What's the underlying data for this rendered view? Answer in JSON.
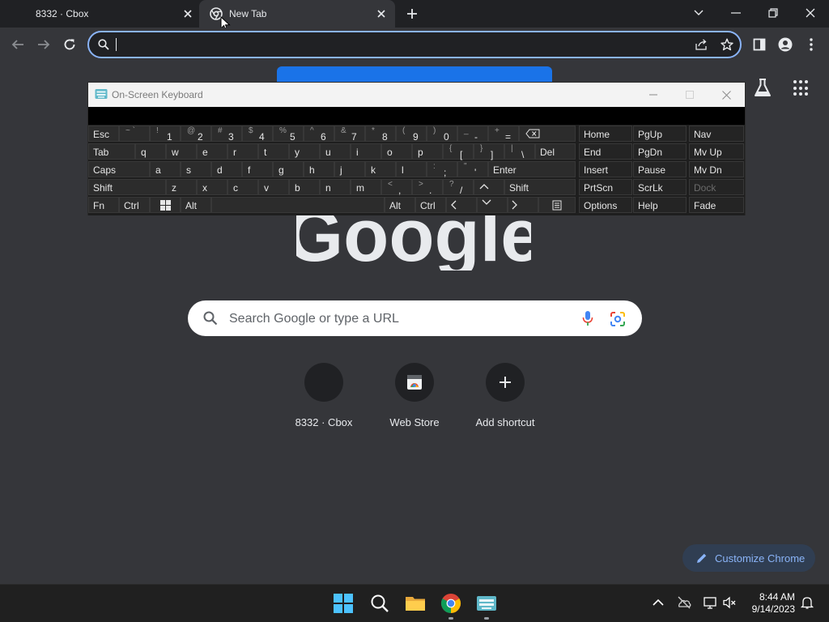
{
  "tabs": [
    {
      "title": "8332 · Cbox",
      "active": false
    },
    {
      "title": "New Tab",
      "active": true
    }
  ],
  "omnibox": {
    "value": "",
    "placeholder": ""
  },
  "page": {
    "logo_text": "Google",
    "search_placeholder": "Search Google or type a URL",
    "shortcuts": [
      {
        "label": "8332 · Cbox",
        "icon": "blank-favicon"
      },
      {
        "label": "Web Store",
        "icon": "web-store-icon"
      },
      {
        "label": "Add shortcut",
        "icon": "plus-icon"
      }
    ],
    "customize_label": "Customize Chrome"
  },
  "osk": {
    "title": "On-Screen Keyboard",
    "row1": {
      "esc": "Esc",
      "tilde": {
        "top": "~",
        "main": "`"
      },
      "n1": {
        "top": "!",
        "main": "1"
      },
      "n2": {
        "top": "@",
        "main": "2"
      },
      "n3": {
        "top": "#",
        "main": "3"
      },
      "n4": {
        "top": "$",
        "main": "4"
      },
      "n5": {
        "top": "%",
        "main": "5"
      },
      "n6": {
        "top": "^",
        "main": "6"
      },
      "n7": {
        "top": "&",
        "main": "7"
      },
      "n8": {
        "top": "*",
        "main": "8"
      },
      "n9": {
        "top": "(",
        "main": "9"
      },
      "n0": {
        "top": ")",
        "main": "0"
      },
      "minus": {
        "top": "_",
        "main": "-"
      },
      "equals": {
        "top": "+",
        "main": "="
      }
    },
    "row2": {
      "tab": "Tab",
      "letters": [
        "q",
        "w",
        "e",
        "r",
        "t",
        "y",
        "u",
        "i",
        "o",
        "p"
      ],
      "lbracket": {
        "top": "{",
        "main": "["
      },
      "rbracket": {
        "top": "}",
        "main": "]"
      },
      "backslash": {
        "top": "|",
        "main": "\\"
      },
      "del": "Del"
    },
    "row3": {
      "caps": "Caps",
      "letters": [
        "a",
        "s",
        "d",
        "f",
        "g",
        "h",
        "j",
        "k",
        "l"
      ],
      "semicolon": {
        "top": ":",
        "main": ";"
      },
      "quote": {
        "top": "\"",
        "main": "'"
      },
      "enter": "Enter"
    },
    "row4": {
      "shift_left": "Shift",
      "letters": [
        "z",
        "x",
        "c",
        "v",
        "b",
        "n",
        "m"
      ],
      "comma": {
        "top": "<",
        "main": ","
      },
      "period": {
        "top": ">",
        "main": "."
      },
      "slash": {
        "top": "?",
        "main": "/"
      },
      "shift_right": "Shift"
    },
    "row5": {
      "fn": "Fn",
      "ctrl_left": "Ctrl",
      "alt_left": "Alt",
      "alt_right": "Alt",
      "ctrl_right": "Ctrl"
    },
    "nav": {
      "home": "Home",
      "pgup": "PgUp",
      "nav": "Nav",
      "end": "End",
      "pgdn": "PgDn",
      "mvup": "Mv Up",
      "insert": "Insert",
      "pause": "Pause",
      "mvdn": "Mv Dn",
      "prtscn": "PrtScn",
      "scrlk": "ScrLk",
      "dock": "Dock",
      "options": "Options",
      "help": "Help",
      "fade": "Fade"
    }
  },
  "taskbar": {
    "time": "8:44 AM",
    "date": "9/14/2023"
  },
  "colors": {
    "accent": "#8ab4f8",
    "page_bg": "#35363a",
    "tabstrip_bg": "#202124",
    "taskbar_bg": "#202020",
    "osk_key": "#2c2c2c"
  }
}
